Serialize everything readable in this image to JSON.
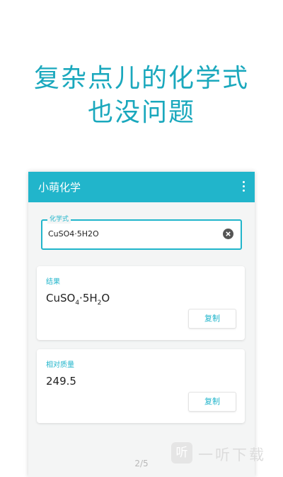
{
  "headline": {
    "line1": "复杂点儿的化学式",
    "line2": "也没问题"
  },
  "app": {
    "title": "小萌化学"
  },
  "input": {
    "label": "化学式",
    "value": "CuSO4·5H2O"
  },
  "result_card": {
    "label": "结果",
    "formula_parts": [
      "CuSO",
      "4",
      "·5H",
      "2",
      "O"
    ],
    "copy_label": "复制"
  },
  "mass_card": {
    "label": "相对质量",
    "value": "249.5",
    "copy_label": "复制"
  },
  "pager": "2/5",
  "watermark": {
    "logo_char": "听",
    "text": "一听下载"
  },
  "colors": {
    "accent": "#21b5cb",
    "headline": "#1aa8bd"
  }
}
